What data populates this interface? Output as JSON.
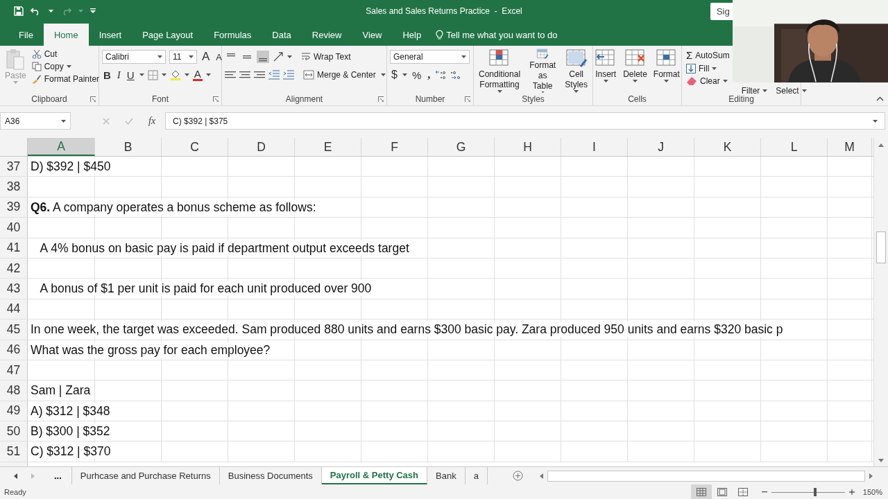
{
  "window": {
    "title": "Sales and Sales Returns Practice  -  Excel",
    "sign_in": "Sig"
  },
  "menu_tabs": [
    {
      "label": "File",
      "selected": false
    },
    {
      "label": "Home",
      "selected": true
    },
    {
      "label": "Insert",
      "selected": false
    },
    {
      "label": "Page Layout",
      "selected": false
    },
    {
      "label": "Formulas",
      "selected": false
    },
    {
      "label": "Data",
      "selected": false
    },
    {
      "label": "Review",
      "selected": false
    },
    {
      "label": "View",
      "selected": false
    },
    {
      "label": "Help",
      "selected": false
    }
  ],
  "tell_me": {
    "placeholder": "Tell me what you want to do"
  },
  "ribbon": {
    "clipboard": {
      "label": "Clipboard",
      "paste": "Paste",
      "cut": "Cut",
      "copy": "Copy",
      "format_painter": "Format Painter"
    },
    "font": {
      "label": "Font",
      "font_name": "Calibri",
      "font_size": "11",
      "grow": "A",
      "shrink": "A",
      "bold": "B",
      "italic": "I",
      "underline": "U",
      "font_color": "A"
    },
    "alignment": {
      "label": "Alignment",
      "wrap_text": "Wrap Text",
      "merge": "Merge & Center"
    },
    "number": {
      "label": "Number",
      "format": "General",
      "currency": "$",
      "percent": "%",
      "comma": ","
    },
    "styles": {
      "label": "Styles",
      "buttons": [
        {
          "lines": [
            "Conditional",
            "Formatting"
          ]
        },
        {
          "lines": [
            "Format as",
            "Table"
          ]
        },
        {
          "lines": [
            "Cell",
            "Styles"
          ]
        }
      ]
    },
    "cells": {
      "label": "Cells",
      "buttons": [
        "Insert",
        "Delete",
        "Format"
      ]
    },
    "editing": {
      "label": "Editing",
      "sigma": "Σ",
      "autosum": "AutoSum",
      "fill": "Fill",
      "clear": "Clear",
      "sort_filter": "Filter",
      "find_select": "Select"
    }
  },
  "formula_bar": {
    "name_box": "A36",
    "fx": "fx",
    "formula": "C) $392 | $375"
  },
  "columns": [
    {
      "label": "A",
      "selected": true
    },
    {
      "label": "B",
      "selected": false
    },
    {
      "label": "C",
      "selected": false
    },
    {
      "label": "D",
      "selected": false
    },
    {
      "label": "E",
      "selected": false
    },
    {
      "label": "F",
      "selected": false
    },
    {
      "label": "G",
      "selected": false
    },
    {
      "label": "H",
      "selected": false
    },
    {
      "label": "I",
      "selected": false
    },
    {
      "label": "J",
      "selected": false
    },
    {
      "label": "K",
      "selected": false
    },
    {
      "label": "L",
      "selected": false
    },
    {
      "label": "M",
      "selected": false
    }
  ],
  "rows": [
    {
      "number": "37",
      "text": "D) $392 | $450"
    },
    {
      "number": "38"
    },
    {
      "number": "39",
      "text": "**Q6.** A company operates a bonus scheme as follows:"
    },
    {
      "number": "40"
    },
    {
      "number": "41",
      "text": "   A 4% bonus on basic pay is paid if department output exceeds target"
    },
    {
      "number": "42"
    },
    {
      "number": "43",
      "text": "   A bonus of $1 per unit is paid for each unit produced over 900"
    },
    {
      "number": "44"
    },
    {
      "number": "45",
      "text": "In one week, the target was exceeded. Sam produced 880 units and earns $300 basic pay. Zara produced 950 units and earns $320 basic p"
    },
    {
      "number": "46",
      "text": "What was the gross pay for each employee?"
    },
    {
      "number": "47"
    },
    {
      "number": "48",
      "text": "Sam | Zara"
    },
    {
      "number": "49",
      "text": "A) $312 | $348"
    },
    {
      "number": "50",
      "text": "B) $300 | $352"
    },
    {
      "number": "51",
      "text": "C) $312 | $370"
    }
  ],
  "sheet_tabs": {
    "more": "...",
    "tabs": [
      {
        "label": "Purhcase and Purchase Returns",
        "selected": false
      },
      {
        "label": "Business Documents",
        "selected": false
      },
      {
        "label": "Payroll & Petty Cash",
        "selected": true
      },
      {
        "label": "Bank",
        "selected": false
      },
      {
        "label": "a",
        "selected": false
      }
    ]
  },
  "status_bar": {
    "status": "Ready",
    "views": [
      {
        "selected": true
      },
      {
        "selected": false
      },
      {
        "selected": false
      }
    ],
    "zoom": {
      "level": 0.6,
      "reading": "150%"
    }
  }
}
